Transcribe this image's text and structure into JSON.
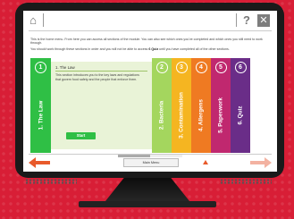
{
  "topbar": {
    "home_icon": "home-icon",
    "help_label": "?",
    "close_label": "✕"
  },
  "intro": {
    "p1": "This is the home menu. From here you can access all sections of the module. You can also see which ones you've completed and which ones you still need to work through.",
    "p2_pre": "You should work through these sections in order and you will not be able to access ",
    "p2_bold": "6 Quiz",
    "p2_post": " until you have completed all of the other sections."
  },
  "sections": [
    {
      "num": "1",
      "label": "1. The Law",
      "color": "#2fbf45",
      "active": true
    },
    {
      "num": "2",
      "label": "2. Bacteria",
      "color": "#a4d65e"
    },
    {
      "num": "3",
      "label": "3. Contamination",
      "color": "#f5b521"
    },
    {
      "num": "4",
      "label": "4. Allergens",
      "color": "#ef7a22"
    },
    {
      "num": "5",
      "label": "5. Paperwork",
      "color": "#c0286f"
    },
    {
      "num": "6",
      "label": "6. Quiz",
      "color": "#6a2d88"
    }
  ],
  "active_section": {
    "title": "1. The Law",
    "description": "This section introduces you to the key laws and regulations that govern food safety and the people that enforce them.",
    "start_label": "Start"
  },
  "bottombar": {
    "prev_icon": "arrow-left-icon",
    "next_icon": "arrow-right-icon",
    "main_menu_label": "Main Menu",
    "progress": 0.5
  },
  "colors": {
    "background": "#d81e36",
    "prev_arrow": "#e85a2b",
    "next_arrow": "#f3b2a1"
  }
}
